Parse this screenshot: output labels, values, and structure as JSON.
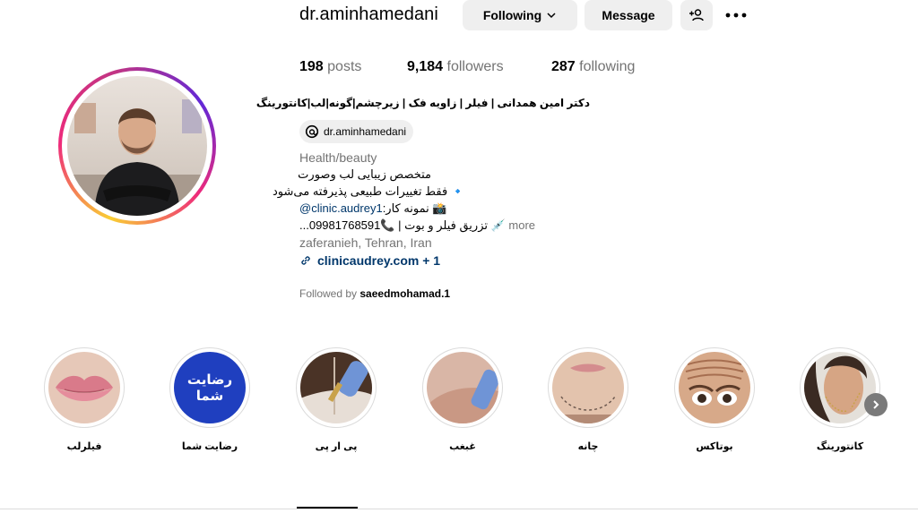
{
  "profile": {
    "username": "dr.aminhamedani",
    "buttons": {
      "following": "Following",
      "message": "Message"
    },
    "stats": {
      "posts_count": "198",
      "posts_label": "posts",
      "followers_count": "9,184",
      "followers_label": "followers",
      "following_count": "287",
      "following_label": "following"
    },
    "full_name": "دکتر امین همدانی | فیلر | زاویه فک | زیرچشم|گونه|لب|کانتورینگ",
    "threads_handle": "dr.aminhamedani",
    "category": "Health/beauty",
    "bio_lines": {
      "line1": "متخصص زیبایی لب وصورت",
      "line2": "🔹 فقط تغییرات طبیعی پذیرفته می‌شود",
      "line3_text": "📸 نمونه کار: ",
      "line3_link": "@clinic.audrey1",
      "line4": "💉 تزریق فیلر و بوت | 📞09981768591...",
      "more": "more"
    },
    "address": "zaferanieh, Tehran, Iran",
    "website": "clinicaudrey.com + 1",
    "followed_by_prefix": "Followed by",
    "followed_by_user": "saeedmohamad.1"
  },
  "highlights": [
    {
      "label": "فیلرلب"
    },
    {
      "label": "رضایت شما",
      "cover_text": "رضایت شما"
    },
    {
      "label": "پی ار پی"
    },
    {
      "label": "غبغب"
    },
    {
      "label": "چانه"
    },
    {
      "label": "بوتاکس"
    },
    {
      "label": "کانتورینگ"
    }
  ],
  "colors": {
    "link": "#00376b",
    "button_bg": "#efefef",
    "muted": "#737373",
    "highlight_blue": "#1f3fbf"
  }
}
